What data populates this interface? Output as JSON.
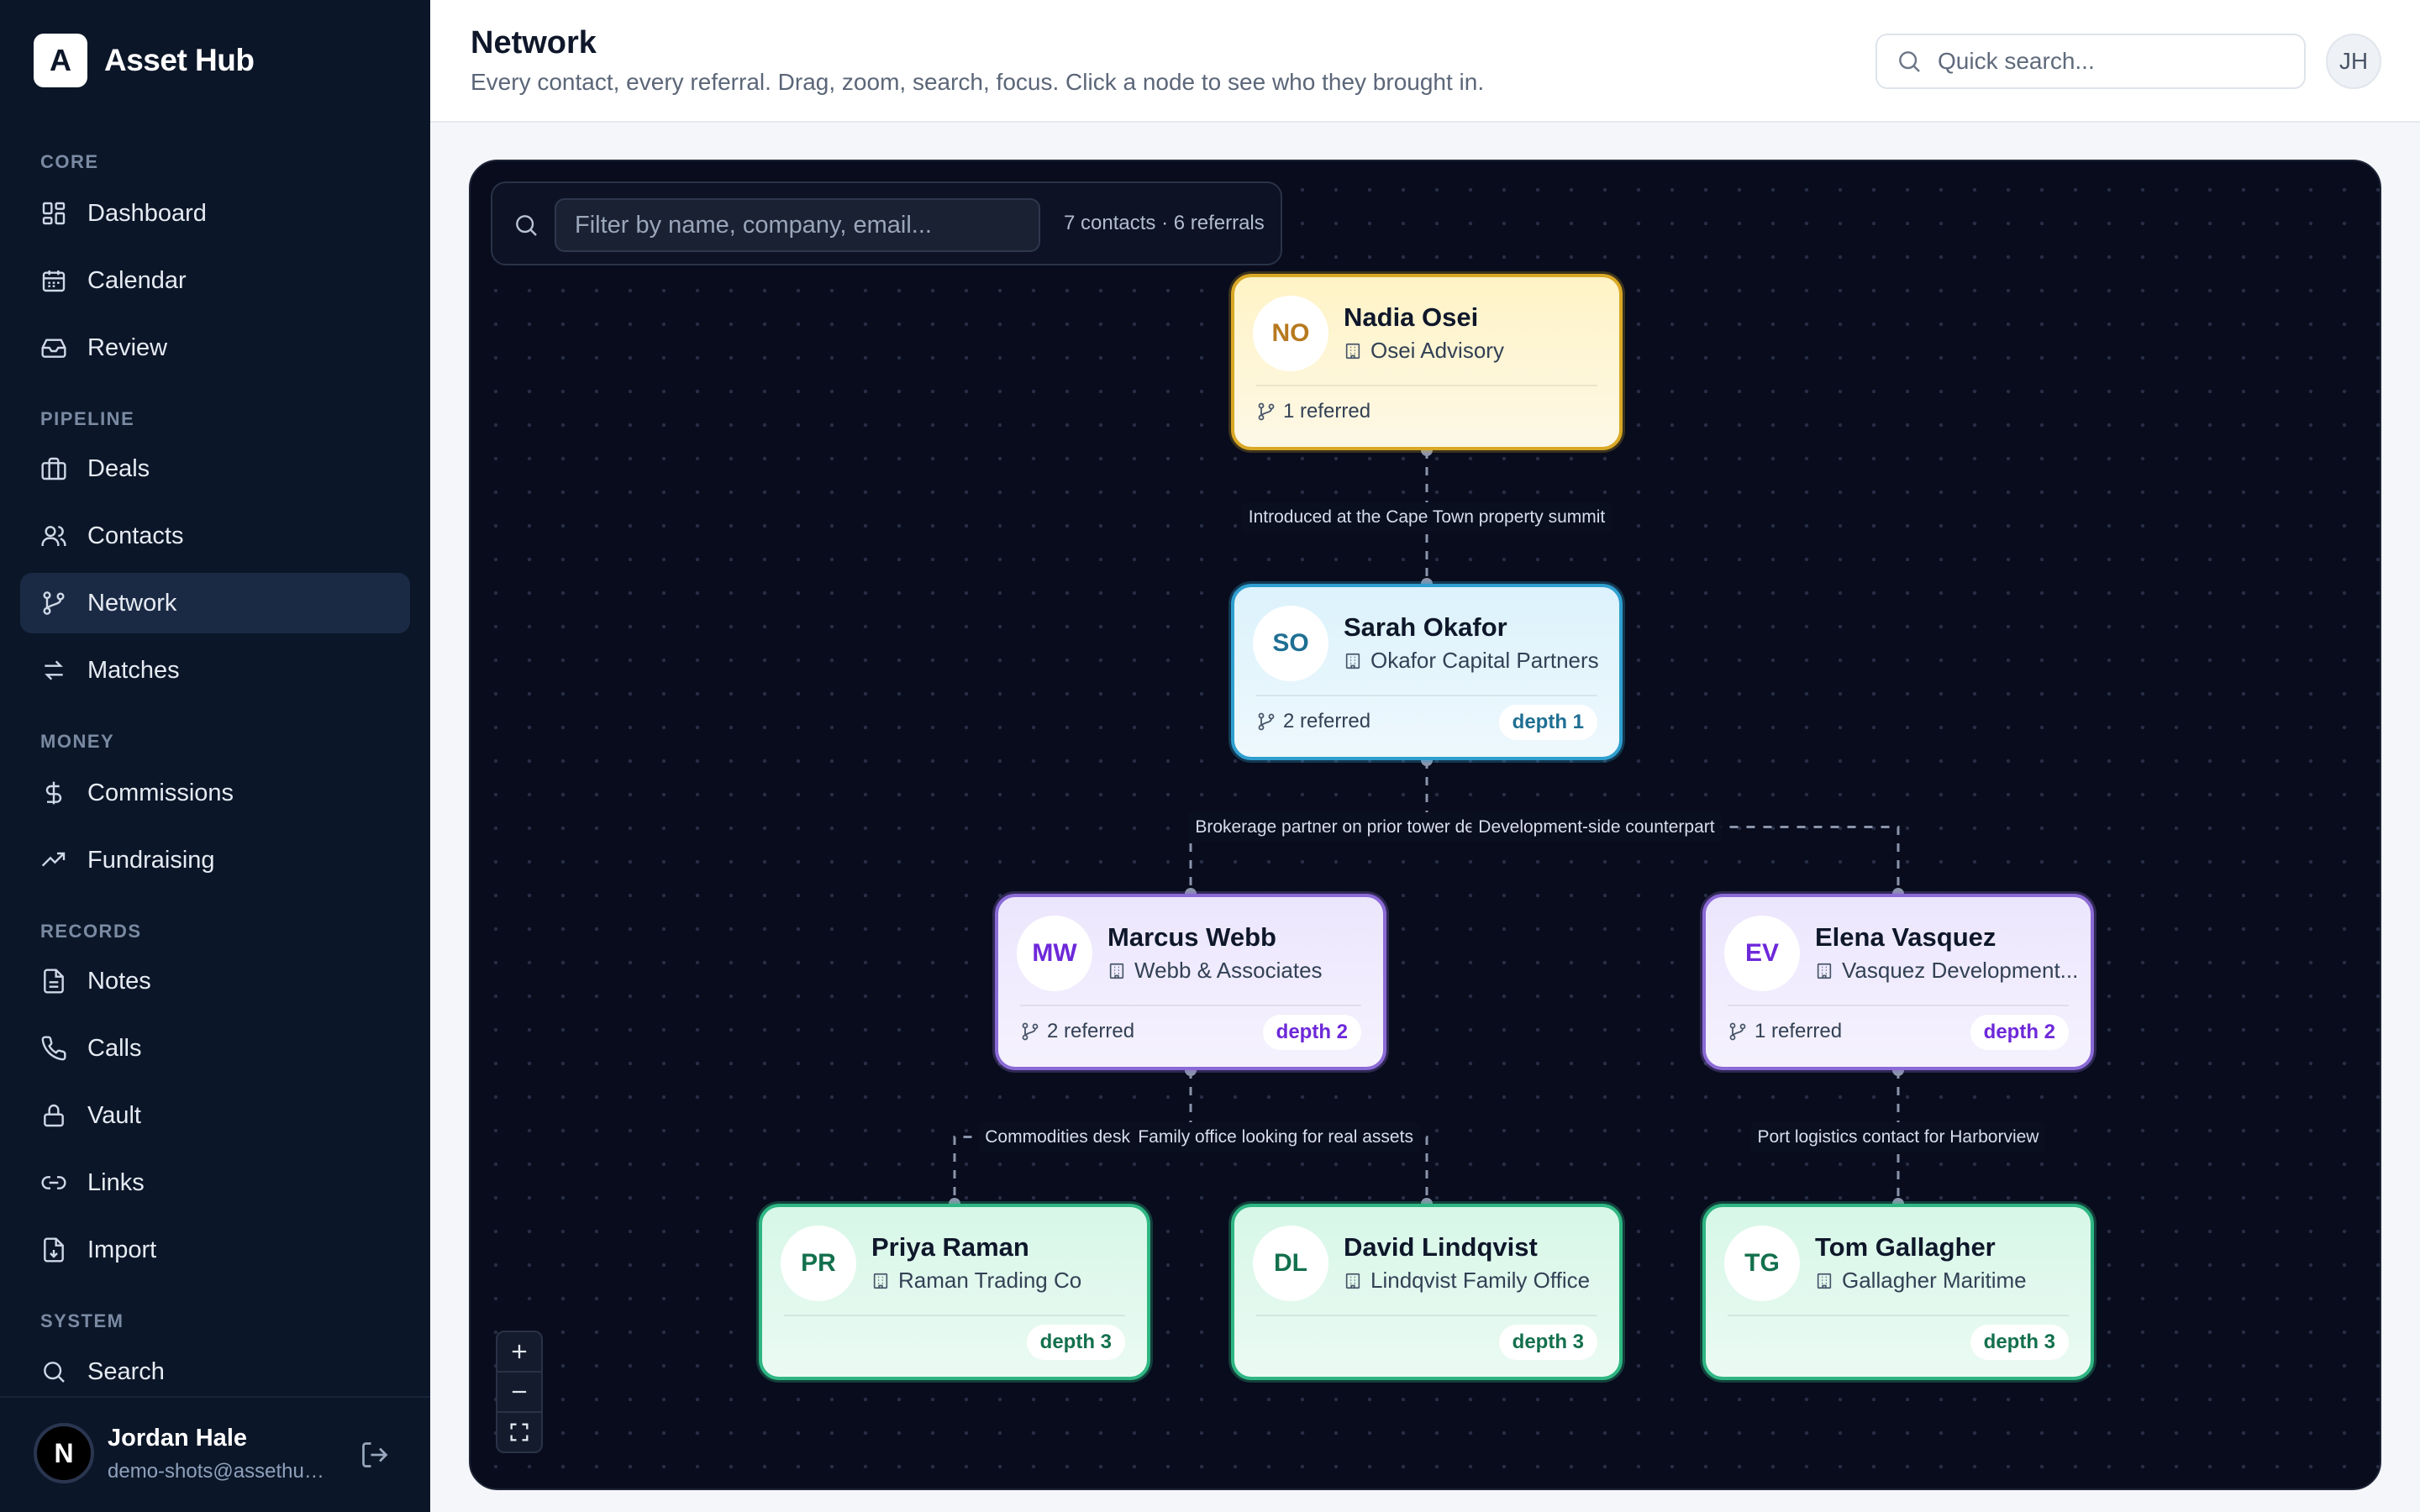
{
  "brand": {
    "logo_letter": "A",
    "name": "Asset Hub"
  },
  "sidebar": {
    "sections": [
      {
        "label": "CORE",
        "items": [
          {
            "label": "Dashboard",
            "icon": "dashboard-icon"
          },
          {
            "label": "Calendar",
            "icon": "calendar-icon"
          },
          {
            "label": "Review",
            "icon": "inbox-icon"
          }
        ]
      },
      {
        "label": "PIPELINE",
        "items": [
          {
            "label": "Deals",
            "icon": "briefcase-icon"
          },
          {
            "label": "Contacts",
            "icon": "users-icon"
          },
          {
            "label": "Network",
            "icon": "branch-icon",
            "active": true
          },
          {
            "label": "Matches",
            "icon": "swap-icon"
          }
        ]
      },
      {
        "label": "MONEY",
        "items": [
          {
            "label": "Commissions",
            "icon": "dollar-icon"
          },
          {
            "label": "Fundraising",
            "icon": "trend-up-icon"
          }
        ]
      },
      {
        "label": "RECORDS",
        "items": [
          {
            "label": "Notes",
            "icon": "file-icon"
          },
          {
            "label": "Calls",
            "icon": "phone-icon"
          },
          {
            "label": "Vault",
            "icon": "lock-icon"
          },
          {
            "label": "Links",
            "icon": "link-icon"
          },
          {
            "label": "Import",
            "icon": "import-icon"
          }
        ]
      },
      {
        "label": "SYSTEM",
        "items": [
          {
            "label": "Search",
            "icon": "search-icon"
          }
        ]
      }
    ],
    "user": {
      "initial": "N",
      "name": "Jordan Hale",
      "email": "demo-shots@assethub.app"
    }
  },
  "header": {
    "title": "Network",
    "subtitle": "Every contact, every referral. Drag, zoom, search, focus. Click a node to see who they brought in.",
    "search_placeholder": "Quick search...",
    "avatar_initials": "JH"
  },
  "canvas": {
    "filter_placeholder": "Filter by name, company, email...",
    "stats": "7 contacts · 6 referrals",
    "nodes": [
      {
        "initials": "NO",
        "name": "Nadia Osei",
        "company": "Osei Advisory",
        "referred": "1 referred",
        "depth": "",
        "tier": "root"
      },
      {
        "initials": "SO",
        "name": "Sarah Okafor",
        "company": "Okafor Capital Partners",
        "referred": "2 referred",
        "depth": "depth 1",
        "tier": "d1"
      },
      {
        "initials": "MW",
        "name": "Marcus Webb",
        "company": "Webb & Associates",
        "referred": "2 referred",
        "depth": "depth 2",
        "tier": "d2"
      },
      {
        "initials": "EV",
        "name": "Elena Vasquez",
        "company": "Vasquez Development...",
        "referred": "1 referred",
        "depth": "depth 2",
        "tier": "d2"
      },
      {
        "initials": "PR",
        "name": "Priya Raman",
        "company": "Raman Trading Co",
        "referred": "",
        "depth": "depth 3",
        "tier": "d3"
      },
      {
        "initials": "DL",
        "name": "David Lindqvist",
        "company": "Lindqvist Family Office",
        "referred": "",
        "depth": "depth 3",
        "tier": "d3"
      },
      {
        "initials": "TG",
        "name": "Tom Gallagher",
        "company": "Gallagher Maritime",
        "referred": "",
        "depth": "depth 3",
        "tier": "d3"
      }
    ],
    "edges": [
      {
        "from": 0,
        "to": 1,
        "label": "Introduced at the Cape Town property summit"
      },
      {
        "from": 1,
        "to": 2,
        "label": "Brokerage partner on prior tower deal"
      },
      {
        "from": 1,
        "to": 3,
        "label": "Development-side counterpart"
      },
      {
        "from": 2,
        "to": 4,
        "label": "Commodities desk introduction"
      },
      {
        "from": 2,
        "to": 5,
        "label": "Family office looking for real assets"
      },
      {
        "from": 3,
        "to": 6,
        "label": "Port logistics contact for Harborview"
      }
    ],
    "zoom_controls": [
      "zoom-in-icon",
      "zoom-out-icon",
      "fit-view-icon"
    ]
  },
  "colors": {
    "sidebar_bg": "#0b1628",
    "canvas_bg": "#080c1c",
    "root_border": "#d9a825",
    "depth1_border": "#2f9fcf",
    "depth2_border": "#8b6bd6",
    "depth3_border": "#2fb683"
  }
}
